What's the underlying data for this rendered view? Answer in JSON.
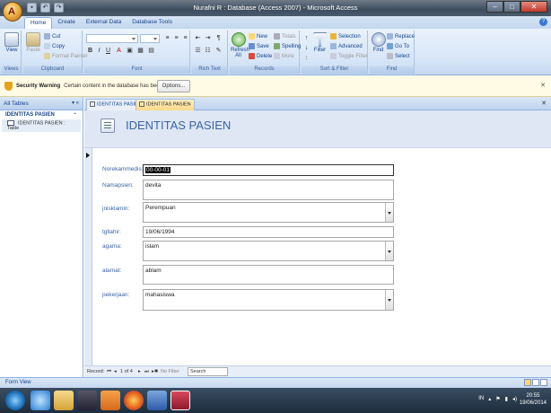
{
  "window": {
    "title": "Nurafni R : Database (Access 2007) - Microsoft Access"
  },
  "ribbon": {
    "tabs": [
      {
        "label": "Home",
        "active": true
      },
      {
        "label": "Create",
        "active": false
      },
      {
        "label": "External Data",
        "active": false
      },
      {
        "label": "Database Tools",
        "active": false
      }
    ],
    "groups": {
      "views": {
        "label": "Views",
        "view": "View"
      },
      "clipboard": {
        "label": "Clipboard",
        "paste": "Paste",
        "cut": "Cut",
        "copy": "Copy",
        "format_painter": "Format Painter"
      },
      "font": {
        "label": "Font"
      },
      "rich_text": {
        "label": "Rich Text"
      },
      "records": {
        "label": "Records",
        "refresh": "Refresh All",
        "new": "New",
        "save": "Save",
        "delete": "Delete",
        "totals": "Totals",
        "spelling": "Spelling",
        "more": "More"
      },
      "sort_filter": {
        "label": "Sort & Filter",
        "filter": "Filter",
        "selection": "Selection",
        "advanced": "Advanced",
        "toggle_filter": "Toggle Filter"
      },
      "find": {
        "label": "Find",
        "find": "Find",
        "replace": "Replace",
        "goto": "Go To",
        "select": "Select"
      }
    }
  },
  "security_bar": {
    "title": "Security Warning",
    "message": "Certain content in the database has been disabled",
    "options_label": "Options..."
  },
  "nav_pane": {
    "header": "All Tables",
    "group": "IDENTITAS PASIEN",
    "items": [
      {
        "label": "IDENTITAS PASIEN : Table"
      }
    ]
  },
  "doc_tabs": [
    {
      "label": "IDENTITAS PASIEN",
      "active": false
    },
    {
      "label": "IDENTITAS PASIEN",
      "active": true
    }
  ],
  "form": {
    "title": "IDENTITAS PASIEN",
    "fields": [
      {
        "label": "Norekammedis:",
        "value": "00-00-01",
        "dropdown": false
      },
      {
        "label": "Namapsien:",
        "value": "devita",
        "dropdown": false
      },
      {
        "label": "jnisklamin:",
        "value": "Perempuan",
        "dropdown": true
      },
      {
        "label": "tgllahir:",
        "value": "19/06/1994",
        "dropdown": false
      },
      {
        "label": "agama:",
        "value": "islam",
        "dropdown": true
      },
      {
        "label": "alamat:",
        "value": "ablam",
        "dropdown": false
      },
      {
        "label": "pekerjaan:",
        "value": "mahasiswa",
        "dropdown": true
      }
    ]
  },
  "record_nav": {
    "label": "Record:",
    "position": "1 of 4",
    "filter": "No Filter",
    "search": "Search"
  },
  "status": {
    "text": "Form View"
  },
  "taskbar": {
    "tray_lang": "IN",
    "time": "20:55",
    "date": "19/06/2014"
  }
}
